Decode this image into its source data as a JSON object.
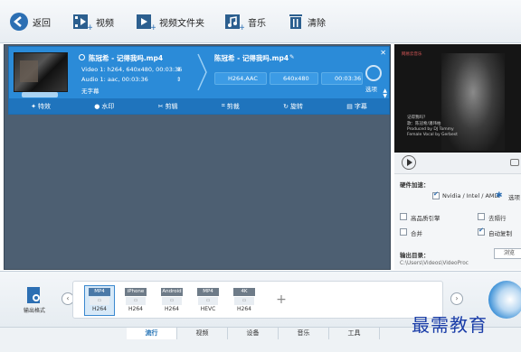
{
  "toolbar": {
    "back": "返回",
    "video": "视频",
    "video_folder": "视频文件夹",
    "music": "音乐",
    "clear": "清除"
  },
  "task": {
    "source_name": "陈冠希 - 记得我吗.mp4",
    "video_info": "Video 1: h264, 640x480, 00:03:36",
    "audio_info": "Audio 1: aac, 00:03:36",
    "subtitle": "无字幕",
    "output_name": "陈冠希 - 记得我吗.mp4",
    "out_codec": "H264,AAC",
    "out_resolution": "640x480",
    "out_duration": "00:03:36",
    "codec_option": "选项",
    "edit_buttons": [
      "特效",
      "水印",
      "剪辑",
      "剪裁",
      "旋转",
      "字幕"
    ]
  },
  "preview": {
    "brand": "网易云音乐",
    "song_line1": "记得我吗？",
    "song_line2": "歌：陈冠希/潘玮柏",
    "credit_line1": "Produced by DJ Tommy",
    "credit_line2": "Female Vocal by Gerbest"
  },
  "options": {
    "hw_accel_label": "硬件加速：",
    "nvidia_label": "Nvidia / Intel / AMD",
    "option_btn": "选项",
    "hq_engine": "高品质引擎",
    "deinterlace": "去隔行",
    "merge": "合并",
    "auto_copy": "自动复制",
    "output_dir_label": "输出目录：",
    "browse": "浏览",
    "output_path": "C:\\Users\\Videos\\VideoProc"
  },
  "format_panel": {
    "output_format_label": "输出格式",
    "formats": [
      {
        "top": "MP4",
        "bottom": "H264"
      },
      {
        "top": "iPhone",
        "bottom": "H264"
      },
      {
        "top": "Android",
        "bottom": "H264"
      },
      {
        "top": "MP4",
        "bottom": "HEVC"
      },
      {
        "top": "4K",
        "bottom": "H264"
      }
    ]
  },
  "tabs": [
    "流行",
    "视频",
    "设备",
    "音乐",
    "工具"
  ],
  "watermark": "最需教育",
  "colors": {
    "accent": "#2b8bd8",
    "list_bg": "#4d5f72"
  }
}
